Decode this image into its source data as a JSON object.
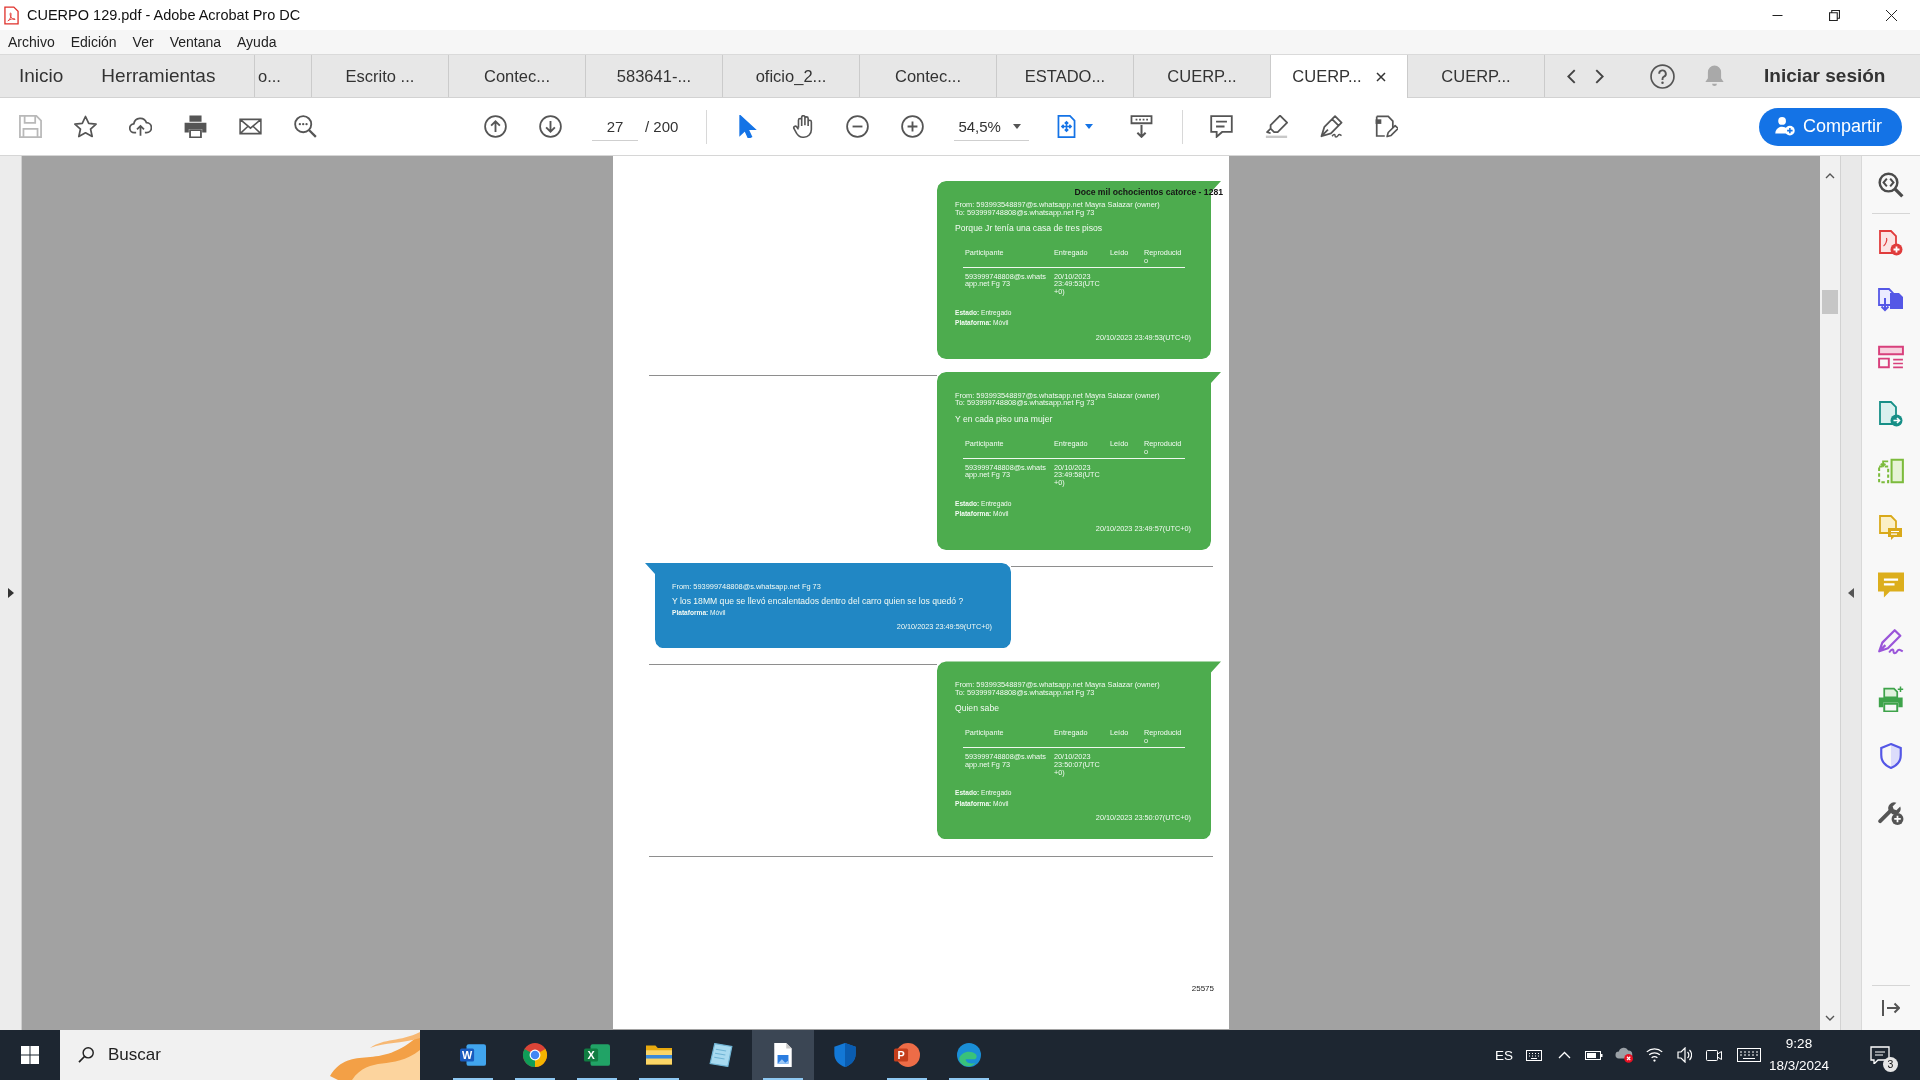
{
  "window": {
    "title": "CUERPO 129.pdf - Adobe Acrobat Pro DC"
  },
  "menu": [
    "Archivo",
    "Edición",
    "Ver",
    "Ventana",
    "Ayuda"
  ],
  "nav": [
    {
      "label": "Inicio",
      "selected": false
    },
    {
      "label": "Herramientas",
      "selected": false
    }
  ],
  "tabs": [
    {
      "label": "o...",
      "selected": false
    },
    {
      "label": "Escrito ...",
      "selected": false
    },
    {
      "label": "Contec...",
      "selected": false
    },
    {
      "label": "583641-...",
      "selected": false
    },
    {
      "label": "oficio_2...",
      "selected": false
    },
    {
      "label": "Contec...",
      "selected": false
    },
    {
      "label": "ESTADO...",
      "selected": false
    },
    {
      "label": "CUERP...",
      "selected": false
    },
    {
      "label": "CUERP...",
      "selected": true
    },
    {
      "label": "CUERP...",
      "selected": false
    }
  ],
  "account": "Iniciar sesión",
  "toolbar": {
    "save": {
      "disabled": true
    },
    "page": "27",
    "page_total": "/ 200",
    "tools": [
      {
        "kind": "select",
        "selected": true
      },
      {
        "kind": "hand",
        "selected": false
      }
    ],
    "zoom": "54,5%",
    "share": "Compartir"
  },
  "document": {
    "stamp": "Doce mil ochocientos catorce - 1281",
    "messages": [
      {
        "kind": "outgoing",
        "from": "From: 593993548897@s.whatsapp.net Mayra Salazar (owner)",
        "to": "To: 593999748808@s.whatsapp.net Fg 73",
        "text": "Porque Jr tenía una casa de tres pisos",
        "columns": [
          "Participante",
          "Entregado",
          "Leído",
          "Reproducido"
        ],
        "receipts": [
          {
            "participant": "593999748808@s.whatsapp.net Fg 73",
            "delivered": "20/10/2023 23:49:53(UTC +0)"
          }
        ],
        "status": "**Estado:** Entregado",
        "platform": "**Plataforma:** Móvil",
        "time": "20/10/2023 23:49:53(UTC+0)"
      },
      {
        "kind": "outgoing",
        "from": "From: 593993548897@s.whatsapp.net Mayra Salazar (owner)",
        "to": "To: 593999748808@s.whatsapp.net Fg 73",
        "text": "Y en cada piso una mujer",
        "columns": [
          "Participante",
          "Entregado",
          "Leído",
          "Reproducido"
        ],
        "receipts": [
          {
            "participant": "593999748808@s.whatsapp.net Fg 73",
            "delivered": "20/10/2023 23:49:58(UTC +0)"
          }
        ],
        "status": "**Estado:** Entregado",
        "platform": "**Plataforma:** Móvil",
        "time": "20/10/2023 23:49:57(UTC+0)"
      },
      {
        "kind": "incoming",
        "from": "From: 593999748808@s.whatsapp.net Fg 73",
        "text": "Y los 18MM que se llevó encalentados dentro del carro quien se los quedó ?",
        "platform": "**Plataforma:** Móvil",
        "time": "20/10/2023 23:49:59(UTC+0)"
      },
      {
        "kind": "outgoing",
        "from": "From: 593993548897@s.whatsapp.net Mayra Salazar (owner)",
        "to": "To: 593999748808@s.whatsapp.net Fg 73",
        "text": "Quien sabe",
        "columns": [
          "Participante",
          "Entregado",
          "Leído",
          "Reproducido"
        ],
        "receipts": [
          {
            "participant": "593999748808@s.whatsapp.net Fg 73",
            "delivered": "20/10/2023 23:50:07(UTC +0)"
          }
        ],
        "status": "**Estado:** Entregado",
        "platform": "**Plataforma:** Móvil",
        "time": "20/10/2023 23:50:07(UTC+0)"
      }
    ],
    "page_number": "25575"
  },
  "taskbar": {
    "search": {
      "placeholder": "Buscar"
    },
    "apps": [
      {
        "kind": "word",
        "letter": "W",
        "running": true,
        "active": false
      },
      {
        "kind": "chrome",
        "running": true,
        "active": false
      },
      {
        "kind": "excel",
        "letter": "X",
        "running": true,
        "active": false
      },
      {
        "kind": "folder",
        "running": true,
        "active": false
      },
      {
        "kind": "note",
        "running": false,
        "active": false
      },
      {
        "kind": "document",
        "running": true,
        "active": true
      },
      {
        "kind": "shield",
        "running": false,
        "active": false
      },
      {
        "kind": "powerpoint",
        "letter": "P",
        "running": true,
        "active": false
      },
      {
        "kind": "edge",
        "running": true,
        "active": false
      }
    ],
    "language": "ES",
    "time": "9:28",
    "date": "18/3/2024",
    "notifications": "3"
  }
}
